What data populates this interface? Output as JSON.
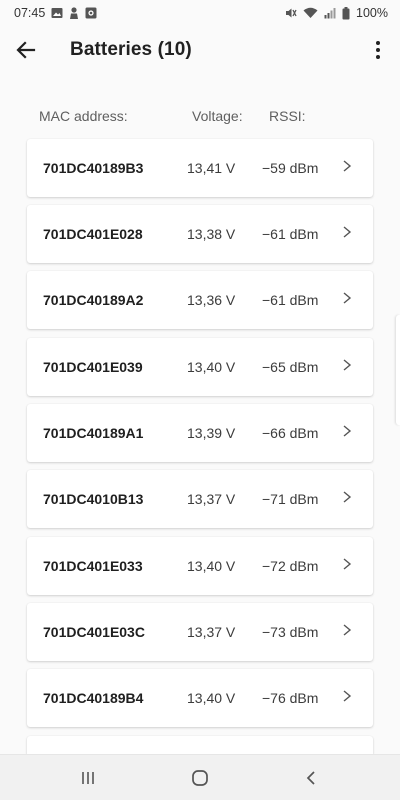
{
  "status_bar": {
    "time": "07:45",
    "battery_percent": "100%",
    "left_icons": [
      "gallery-icon",
      "person-icon",
      "camera-icon"
    ],
    "right_icons": [
      "mute-icon",
      "wifi-icon",
      "signal-icon"
    ]
  },
  "header": {
    "title": "Batteries (10)",
    "back_icon": "arrow-left-icon",
    "menu_icon": "more-vert-icon"
  },
  "columns": {
    "mac": "MAC address:",
    "voltage": "Voltage:",
    "rssi": "RSSI:"
  },
  "batteries": [
    {
      "mac": "701DC40189B3",
      "voltage": "13,41 V",
      "rssi": "−59 dBm"
    },
    {
      "mac": "701DC401E028",
      "voltage": "13,38 V",
      "rssi": "−61 dBm"
    },
    {
      "mac": "701DC40189A2",
      "voltage": "13,36 V",
      "rssi": "−61 dBm"
    },
    {
      "mac": "701DC401E039",
      "voltage": "13,40 V",
      "rssi": "−65 dBm"
    },
    {
      "mac": "701DC40189A1",
      "voltage": "13,39 V",
      "rssi": "−66 dBm"
    },
    {
      "mac": "701DC4010B13",
      "voltage": "13,37 V",
      "rssi": "−71 dBm"
    },
    {
      "mac": "701DC401E033",
      "voltage": "13,40 V",
      "rssi": "−72 dBm"
    },
    {
      "mac": "701DC401E03C",
      "voltage": "13,37 V",
      "rssi": "−73 dBm"
    },
    {
      "mac": "701DC40189B4",
      "voltage": "13,40 V",
      "rssi": "−76 dBm"
    }
  ],
  "nav_bar": {
    "icons": [
      "recents-icon",
      "home-icon",
      "back-icon"
    ]
  },
  "colors": {
    "background": "#fafafa",
    "card": "#ffffff",
    "text_primary": "#212121",
    "text_secondary": "#5f5f5f",
    "nav_bar": "#f1f1f1"
  }
}
